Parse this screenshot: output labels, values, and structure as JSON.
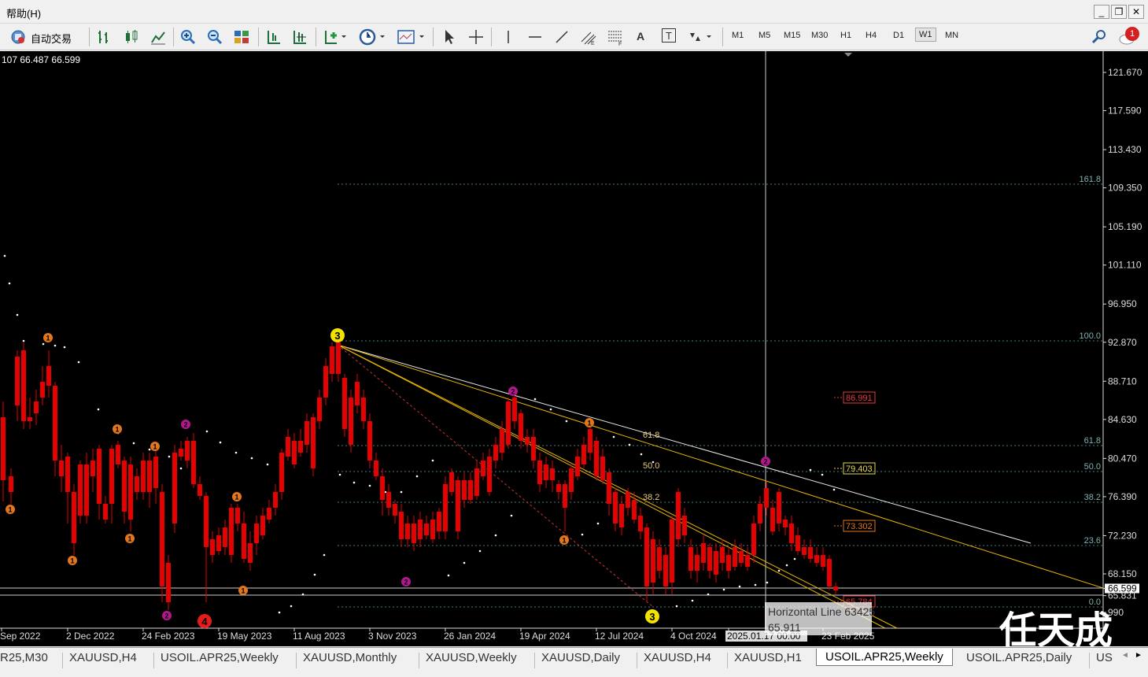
{
  "menu": {
    "help": "帮助(H)"
  },
  "window_controls": {
    "minimize": "_",
    "restore": "❐",
    "close": "✕"
  },
  "toolbar": {
    "auto_trading_label": "自动交易",
    "text_tool": "A",
    "text_label_tool": "T",
    "timeframes": [
      {
        "label": "M1",
        "active": false
      },
      {
        "label": "M5",
        "active": false
      },
      {
        "label": "M15",
        "active": false
      },
      {
        "label": "M30",
        "active": false
      },
      {
        "label": "H1",
        "active": false
      },
      {
        "label": "H4",
        "active": false
      },
      {
        "label": "D1",
        "active": false
      },
      {
        "label": "W1",
        "active": true
      },
      {
        "label": "MN",
        "active": false
      }
    ],
    "notification_count": "1"
  },
  "chart": {
    "ohlc_header": "107 66.487 66.599",
    "price_axis": [
      "121.670",
      "117.590",
      "113.430",
      "109.350",
      "105.190",
      "101.110",
      "96.950",
      "92.870",
      "88.710",
      "84.630",
      "80.470",
      "76.390",
      "72.230",
      "68.150",
      "66.599",
      "65.831",
      "990"
    ],
    "time_axis": [
      "Sep 2022",
      "2 Dec 2022",
      "24 Feb 2023",
      "19 May 2023",
      "11 Aug 2023",
      "3 Nov 2023",
      "26 Jan 2024",
      "19 Apr 2024",
      "12 Jul 2024",
      "4 Oct 2024",
      "2025.01.17 00:00",
      "23 Feb 2025"
    ],
    "fib_right": [
      "161.8",
      "100.0",
      "61.8",
      "50.0",
      "38.2",
      "23.6",
      "0.0"
    ],
    "fib_mid": [
      "61.8",
      "50.0",
      "38.2"
    ],
    "price_tags": [
      "86.991",
      "79.403",
      "73.302",
      "65.784"
    ],
    "tooltip": {
      "line1": "Horizontal Line 63425",
      "line2": "65.911"
    },
    "wave_labels": [
      "1",
      "2",
      "3",
      "4"
    ],
    "watermark": "任天成",
    "colors": {
      "bull": "#00e600",
      "bear": "#e60000",
      "fib_line": "#4a7d7d",
      "fan": "#e8b600",
      "trend": "#e8e8e8",
      "orange_label": "#e2761f",
      "magenta_label": "#b3178d"
    }
  },
  "tabs": [
    {
      "label": "R25,M30",
      "active": false
    },
    {
      "label": "XAUUSD,H4",
      "active": false
    },
    {
      "label": "USOIL.APR25,Weekly",
      "active": false
    },
    {
      "label": "XAUUSD,Monthly",
      "active": false
    },
    {
      "label": "XAUUSD,Weekly",
      "active": false
    },
    {
      "label": "XAUUSD,Daily",
      "active": false
    },
    {
      "label": "XAUUSD,H4",
      "active": false
    },
    {
      "label": "XAUUSD,H1",
      "active": false
    },
    {
      "label": "USOIL.APR25,Weekly",
      "active": true
    },
    {
      "label": "USOIL.APR25,Daily",
      "active": false
    },
    {
      "label": "US",
      "active": false
    }
  ],
  "tab_arrows": {
    "left": "◄",
    "right": "►"
  }
}
